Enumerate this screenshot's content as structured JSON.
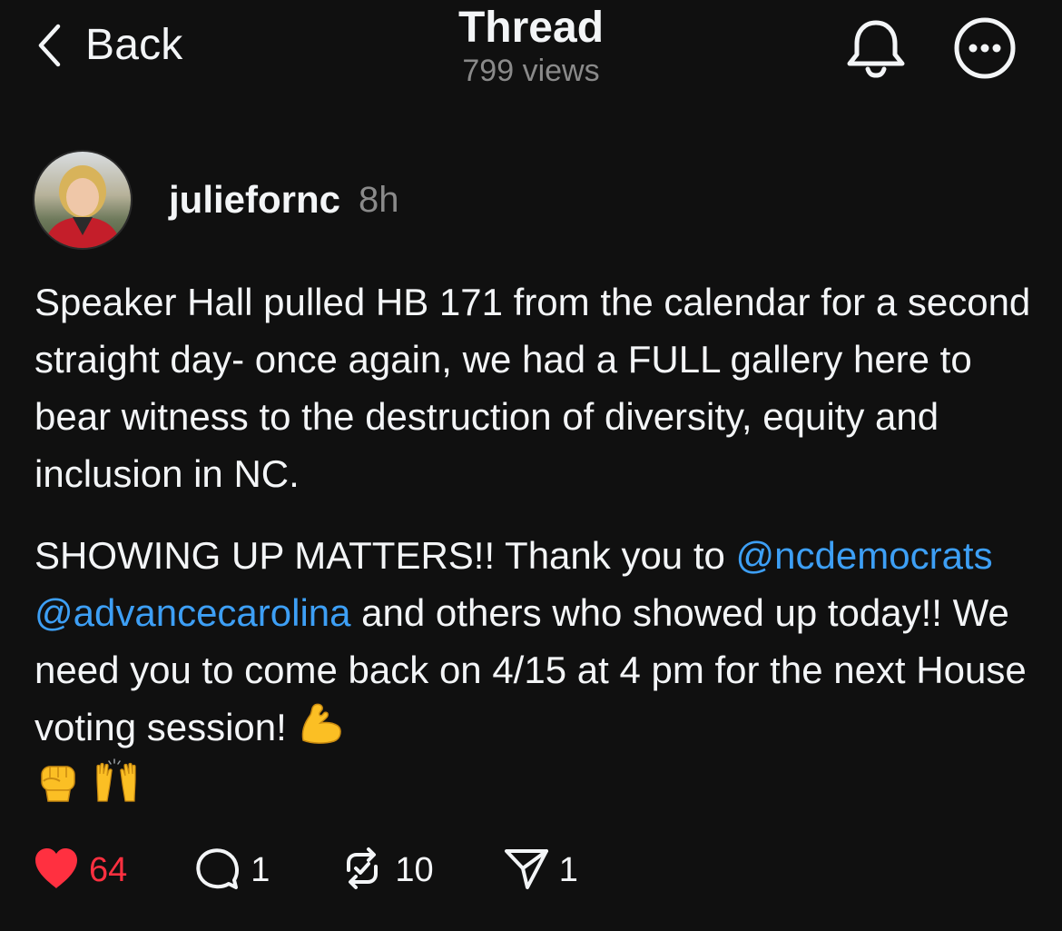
{
  "header": {
    "back_label": "Back",
    "title": "Thread",
    "views": "799 views",
    "icons": [
      "chevron-left-icon",
      "bell-icon",
      "more-icon"
    ]
  },
  "post": {
    "author": "juliefornc",
    "time": "8h",
    "paragraph1": "Speaker Hall pulled HB 171 from the calendar for a second straight day- once again, we had a FULL gallery here to bear witness to the destruction of diversity, equity and inclusion in NC.",
    "paragraph2_start": "SHOWING UP MATTERS!! Thank you to ",
    "mention1": "@ncdemocrats",
    "mention2": "@advancecarolina",
    "paragraph2_end": " and others who showed up today!! We need you to come back on 4/15 at 4 pm for the next House voting session!",
    "emojis": [
      "flexed-biceps",
      "raised-fist",
      "raising-hands"
    ]
  },
  "actions": {
    "likes": "64",
    "replies": "1",
    "reposts": "10",
    "shares": "1"
  },
  "colors": {
    "background": "#101010",
    "text": "#f3f5f7",
    "secondary": "#8a8a8a",
    "mention": "#3d9ff5",
    "like": "#ff3040"
  }
}
